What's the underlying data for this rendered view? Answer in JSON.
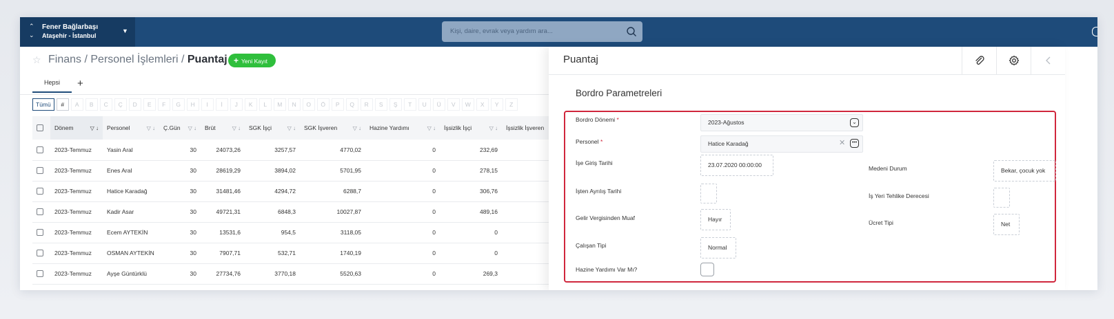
{
  "topbar": {
    "org_name": "Fener Bağlarbaşı",
    "org_city": "Ataşehir - İstanbul",
    "search_placeholder": "Kişi, daire, evrak veya yardım ara...",
    "bg_color": "#1e4b7a"
  },
  "list": {
    "breadcrumb_1": "Finans",
    "breadcrumb_2": "Personel İşlemleri",
    "breadcrumb_3": "Puantaj",
    "sep": " / ",
    "new_button": "Yeni Kayıt",
    "tab_all": "Hepsi",
    "tab_add": "+",
    "filter_all": "Tümü",
    "filter_hash": "#",
    "letters": [
      "A",
      "B",
      "C",
      "Ç",
      "D",
      "E",
      "F",
      "G",
      "H",
      "I",
      "İ",
      "J",
      "K",
      "L",
      "M",
      "N",
      "O",
      "Ö",
      "P",
      "Q",
      "R",
      "S",
      "Ş",
      "T",
      "U",
      "Ü",
      "V",
      "W",
      "X",
      "Y",
      "Z"
    ],
    "columns": [
      "Dönem",
      "Personel",
      "Ç.Gün",
      "Brüt",
      "SGK İşçi",
      "SGK İşveren",
      "Hazine Yardımı",
      "İşsizlik İşçi",
      "İşsizlik İşveren"
    ],
    "rows": [
      [
        "2023-Temmuz",
        "Yasin Aral",
        "30",
        "24073,26",
        "3257,57",
        "4770,02",
        "0",
        "232,69"
      ],
      [
        "2023-Temmuz",
        "Enes Aral",
        "30",
        "28619,29",
        "3894,02",
        "5701,95",
        "0",
        "278,15"
      ],
      [
        "2023-Temmuz",
        "Hatice Karadağ",
        "30",
        "31481,46",
        "4294,72",
        "6288,7",
        "0",
        "306,76"
      ],
      [
        "2023-Temmuz",
        "Kadir Asar",
        "30",
        "49721,31",
        "6848,3",
        "10027,87",
        "0",
        "489,16"
      ],
      [
        "2023-Temmuz",
        "Ecem AYTEKİN",
        "30",
        "13531,6",
        "954,5",
        "3118,05",
        "0",
        "0"
      ],
      [
        "2023-Temmuz",
        "OSMAN AYTEKİN",
        "30",
        "7907,71",
        "532,71",
        "1740,19",
        "0",
        "0"
      ],
      [
        "2023-Temmuz",
        "Ayşe Güntürklü",
        "30",
        "27734,76",
        "3770,18",
        "5520,63",
        "0",
        "269,3"
      ]
    ]
  },
  "detail": {
    "title": "Puantaj",
    "section_title": "Bordro Parametreleri",
    "req_mark": "*",
    "fields": {
      "bordro_donemi_label": "Bordro Dönemi",
      "bordro_donemi_value": "2023-Ağustos",
      "personel_label": "Personel",
      "personel_value": "Hatice Karadağ",
      "ise_giris_label": "İşe Giriş Tarihi",
      "ise_giris_value": "23.07.2020 00:00:00",
      "medeni_durum_label": "Medeni Durum",
      "medeni_durum_value": "Bekar, çocuk yok",
      "isten_ayrilis_label": "İşten Ayrılış Tarihi",
      "is_yeri_tehlike_label": "İş Yeri Tehlike Derecesi",
      "gelir_vergisi_label": "Gelir Vergisinden Muaf",
      "gelir_vergisi_value": "Hayır",
      "ucret_tipi_label": "Ücret Tipi",
      "ucret_tipi_value": "Net",
      "calisan_tipi_label": "Çalışan Tipi",
      "calisan_tipi_value": "Normal",
      "hazine_yardimi_label": "Hazine Yardımı Var Mı?"
    },
    "highlight_color": "#d0263c"
  },
  "icons": [
    "chevron-up-icon",
    "chevron-down-icon",
    "caret-down-icon",
    "search-icon",
    "star-icon",
    "plus-icon",
    "filter-icon",
    "sort-icon",
    "paperclip-icon",
    "gear-icon",
    "back-icon",
    "dropdown-icon",
    "more-icon",
    "clear-icon"
  ]
}
